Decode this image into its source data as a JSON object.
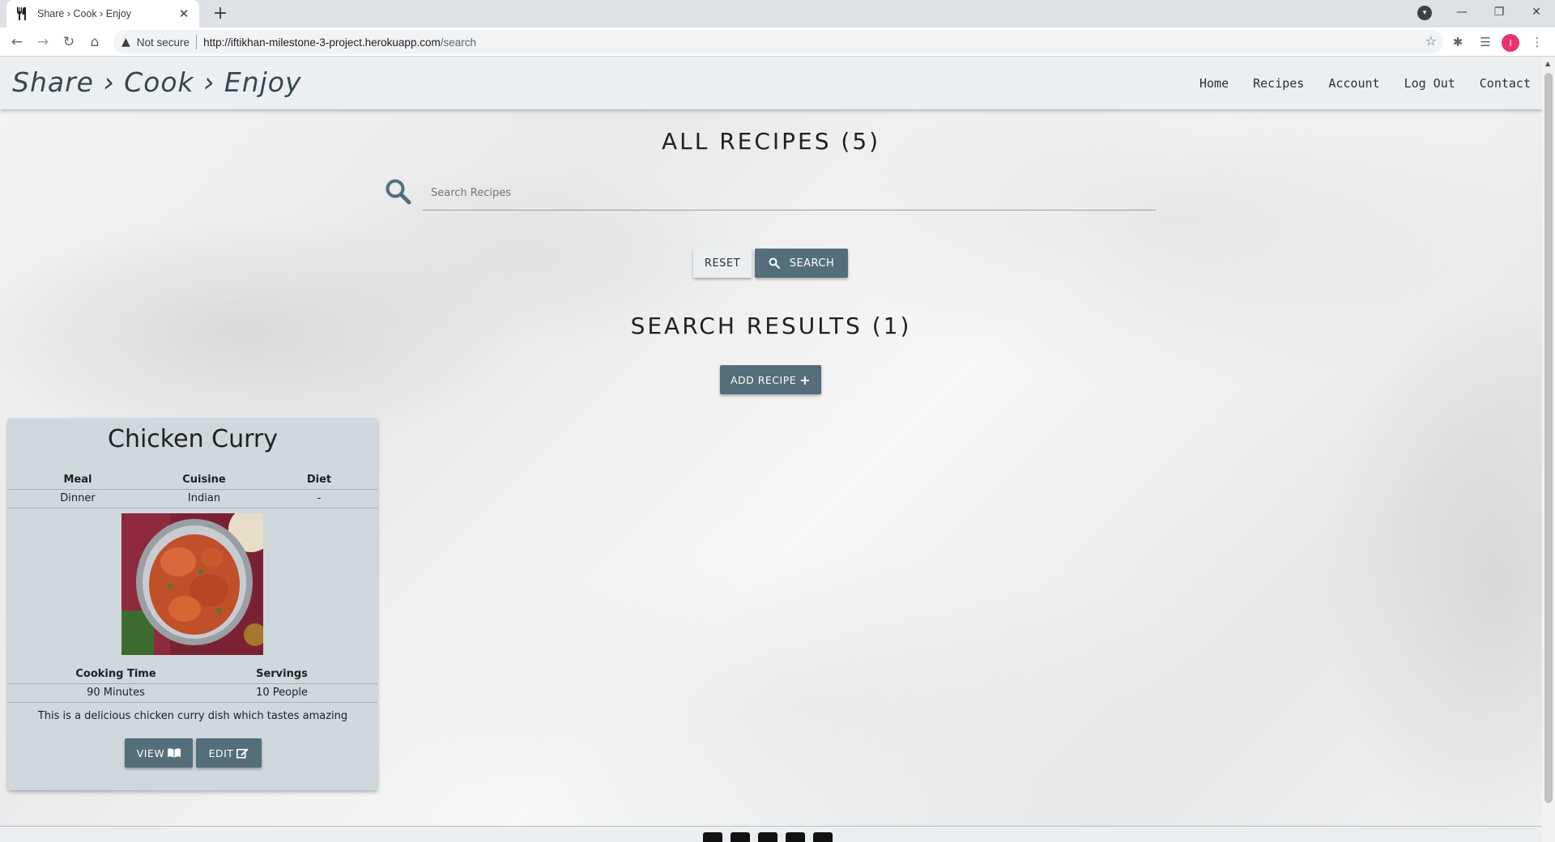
{
  "browser": {
    "tab_title": "Share › Cook › Enjoy",
    "not_secure": "Not secure",
    "url_host": "http://iftikhan-milestone-3-project.herokuapp.com",
    "url_path": "/search",
    "profile_initial": "I"
  },
  "navbar": {
    "brand": "Share › Cook › Enjoy",
    "links": [
      "Home",
      "Recipes",
      "Account",
      "Log Out",
      "Contact"
    ]
  },
  "main": {
    "all_heading": "ALL RECIPES (5)",
    "search_placeholder": "Search Recipes",
    "reset_label": "RESET",
    "search_label": "SEARCH",
    "results_heading": "SEARCH RESULTS (1)",
    "add_label": "ADD RECIPE"
  },
  "card": {
    "title": "Chicken Curry",
    "meal_label": "Meal",
    "cuisine_label": "Cuisine",
    "diet_label": "Diet",
    "meal": "Dinner",
    "cuisine": "Indian",
    "diet": "-",
    "time_label": "Cooking Time",
    "servings_label": "Servings",
    "time": "90 Minutes",
    "servings": "10 People",
    "description": "This is a delicious chicken curry dish which tastes amazing",
    "view_label": "VIEW",
    "edit_label": "EDIT"
  },
  "colors": {
    "accent": "#546e7a",
    "card_bg": "#cfd8dc",
    "navbar_bg": "#eceff1"
  }
}
